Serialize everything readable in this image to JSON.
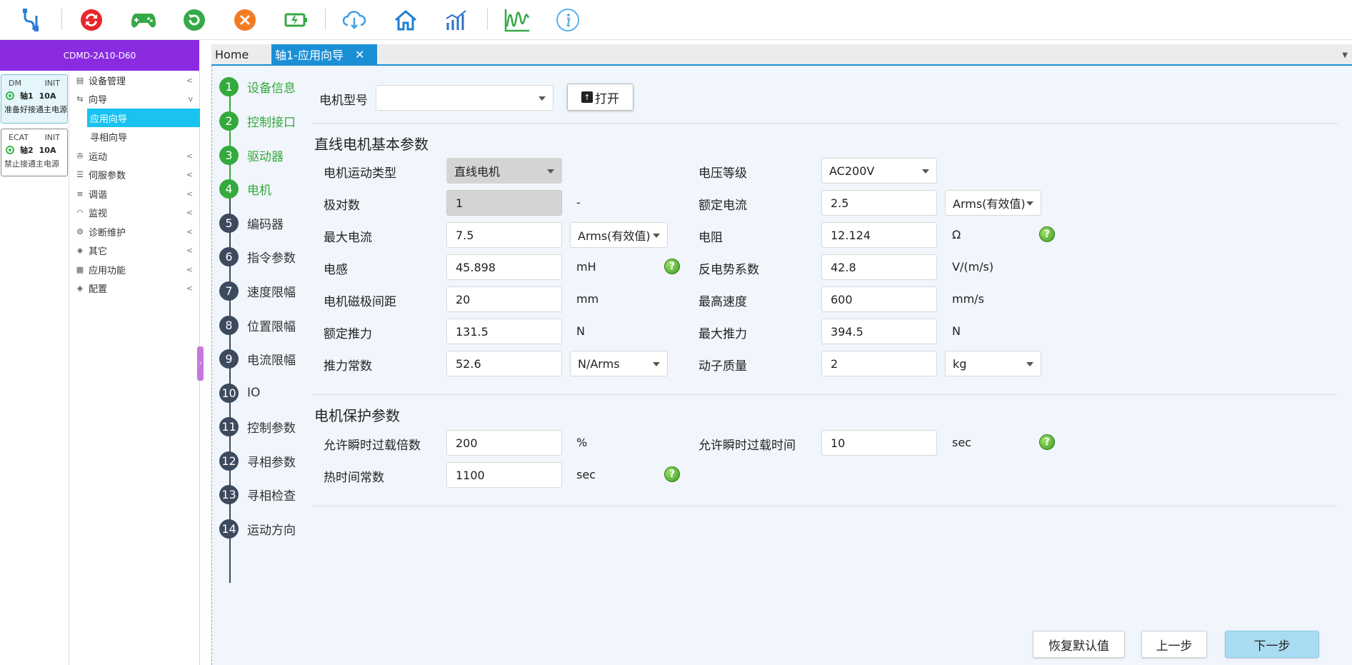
{
  "toolbar": {
    "icons": [
      "usb-connect-icon",
      "reset-icon",
      "gamepad-icon",
      "refresh-icon",
      "close-icon",
      "battery-icon",
      "cloud-download-icon",
      "home-icon",
      "bar-chart-icon",
      "oscilloscope-icon",
      "info-icon"
    ]
  },
  "device": {
    "model": "CDMD-2A10-D60",
    "axes": [
      {
        "protocol": "DM",
        "state": "INIT",
        "name": "轴1",
        "current": "10A",
        "status": "准备好接通主电源"
      },
      {
        "protocol": "ECAT",
        "state": "INIT",
        "name": "轴2",
        "current": "10A",
        "status": "禁止接通主电源"
      }
    ]
  },
  "nav": {
    "items": [
      {
        "label": "设备管理",
        "chev": "<",
        "icon": "database-icon"
      },
      {
        "label": "向导",
        "chev": "v",
        "icon": "wizard-icon"
      },
      {
        "label": "运动",
        "chev": "<",
        "icon": "motion-icon"
      },
      {
        "label": "伺服参数",
        "chev": "<",
        "icon": "params-icon"
      },
      {
        "label": "调谐",
        "chev": "<",
        "icon": "tuning-icon"
      },
      {
        "label": "监视",
        "chev": "<",
        "icon": "gauge-icon"
      },
      {
        "label": "诊断维护",
        "chev": "<",
        "icon": "diagnose-icon"
      },
      {
        "label": "其它",
        "chev": "<",
        "icon": "layers-icon"
      },
      {
        "label": "应用功能",
        "chev": "<",
        "icon": "apps-icon"
      },
      {
        "label": "配置",
        "chev": "<",
        "icon": "config-icon"
      }
    ],
    "sub": [
      {
        "label": "应用向导"
      },
      {
        "label": "寻相向导"
      }
    ]
  },
  "tabs": [
    {
      "label": "Home"
    },
    {
      "label": "轴1-应用向导",
      "close": "✕"
    }
  ],
  "steps": [
    {
      "num": "1",
      "label": "设备信息"
    },
    {
      "num": "2",
      "label": "控制接口"
    },
    {
      "num": "3",
      "label": "驱动器"
    },
    {
      "num": "4",
      "label": "电机"
    },
    {
      "num": "5",
      "label": "编码器"
    },
    {
      "num": "6",
      "label": "指令参数"
    },
    {
      "num": "7",
      "label": "速度限幅"
    },
    {
      "num": "8",
      "label": "位置限幅"
    },
    {
      "num": "9",
      "label": "电流限幅"
    },
    {
      "num": "10",
      "label": "IO"
    },
    {
      "num": "11",
      "label": "控制参数"
    },
    {
      "num": "12",
      "label": "寻相参数"
    },
    {
      "num": "13",
      "label": "寻相检查"
    },
    {
      "num": "14",
      "label": "运动方向"
    }
  ],
  "motor_model": {
    "label": "电机型号",
    "value": "",
    "open_label": "打开"
  },
  "basic": {
    "title": "直线电机基本参数",
    "motion_type": {
      "label": "电机运动类型",
      "value": "直线电机"
    },
    "voltage": {
      "label": "电压等级",
      "value": "AC200V"
    },
    "pole_pairs": {
      "label": "极对数",
      "value": "1",
      "unit": "-"
    },
    "rated_current": {
      "label": "额定电流",
      "value": "2.5",
      "unit": "Arms(有效值)"
    },
    "max_current": {
      "label": "最大电流",
      "value": "7.5",
      "unit": "Arms(有效值)"
    },
    "resistance": {
      "label": "电阻",
      "value": "12.124",
      "unit": "Ω"
    },
    "inductance": {
      "label": "电感",
      "value": "45.898",
      "unit": "mH"
    },
    "back_emf": {
      "label": "反电势系数",
      "value": "42.8",
      "unit": "V/(m/s)"
    },
    "pole_pitch": {
      "label": "电机磁极间距",
      "value": "20",
      "unit": "mm"
    },
    "max_speed": {
      "label": "最高速度",
      "value": "600",
      "unit": "mm/s"
    },
    "rated_force": {
      "label": "额定推力",
      "value": "131.5",
      "unit": "N"
    },
    "max_force": {
      "label": "最大推力",
      "value": "394.5",
      "unit": "N"
    },
    "force_const": {
      "label": "推力常数",
      "value": "52.6",
      "unit": "N/Arms"
    },
    "mover_mass": {
      "label": "动子质量",
      "value": "2",
      "unit": "kg"
    }
  },
  "protect": {
    "title": "电机保护参数",
    "overload_ratio": {
      "label": "允许瞬时过载倍数",
      "value": "200",
      "unit": "%"
    },
    "overload_time": {
      "label": "允许瞬时过载时间",
      "value": "10",
      "unit": "sec"
    },
    "thermal_const": {
      "label": "热时间常数",
      "value": "1100",
      "unit": "sec"
    }
  },
  "footer": {
    "restore": "恢复默认值",
    "prev": "上一步",
    "next": "下一步"
  },
  "help_label": "?"
}
